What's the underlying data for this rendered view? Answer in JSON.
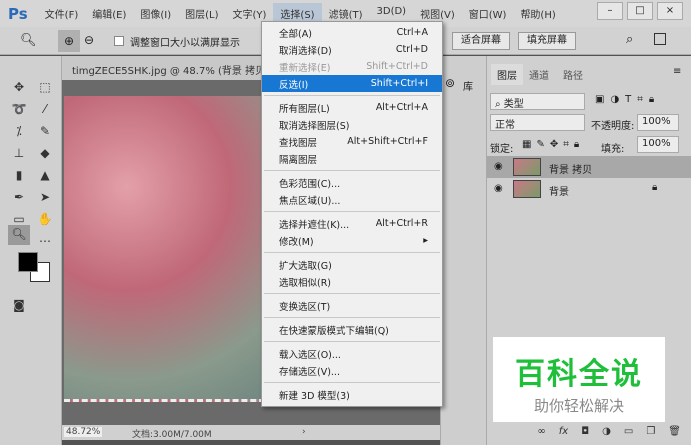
{
  "app": {
    "logo": "Ps"
  },
  "menubar": [
    "文件(F)",
    "编辑(E)",
    "图像(I)",
    "图层(L)",
    "文字(Y)",
    "选择(S)",
    "滤镜(T)",
    "3D(D)",
    "视图(V)",
    "窗口(W)",
    "帮助(H)"
  ],
  "window_buttons": [
    "–",
    "□",
    "×"
  ],
  "options": {
    "resize_label": "调整窗口大小以满屏显示",
    "fit_screen": "适合屏幕",
    "fill_screen": "填充屏幕"
  },
  "document": {
    "tab_title": "timgZECE5SHK.jpg @ 48.7% (背景 拷贝, RG",
    "zoom": "48.72%",
    "doc_size": "文档:3.00M/7.00M"
  },
  "library": {
    "label": "库"
  },
  "layers_panel": {
    "tabs": [
      "图层",
      "通道",
      "路径"
    ],
    "filter": "类型",
    "blend_mode": "正常",
    "opacity_label": "不透明度:",
    "opacity": "100%",
    "lock_label": "锁定:",
    "fill_label": "填充:",
    "fill": "100%",
    "layers": [
      {
        "name": "背景 拷贝",
        "selected": true
      },
      {
        "name": "背景",
        "locked": true
      }
    ]
  },
  "select_menu": [
    {
      "label": "全部(A)",
      "shortcut": "Ctrl+A"
    },
    {
      "label": "取消选择(D)",
      "shortcut": "Ctrl+D"
    },
    {
      "label": "重新选择(E)",
      "shortcut": "Shift+Ctrl+D",
      "disabled": true
    },
    {
      "label": "反选(I)",
      "shortcut": "Shift+Ctrl+I",
      "highlighted": true
    },
    {
      "sep": true
    },
    {
      "label": "所有图层(L)",
      "shortcut": "Alt+Ctrl+A"
    },
    {
      "label": "取消选择图层(S)",
      "shortcut": ""
    },
    {
      "label": "查找图层",
      "shortcut": "Alt+Shift+Ctrl+F"
    },
    {
      "label": "隔离图层",
      "shortcut": ""
    },
    {
      "sep": true
    },
    {
      "label": "色彩范围(C)...",
      "shortcut": ""
    },
    {
      "label": "焦点区域(U)...",
      "shortcut": ""
    },
    {
      "sep": true
    },
    {
      "label": "选择并遮住(K)...",
      "shortcut": "Alt+Ctrl+R"
    },
    {
      "label": "修改(M)",
      "shortcut": "▸"
    },
    {
      "sep": true
    },
    {
      "label": "扩大选取(G)",
      "shortcut": ""
    },
    {
      "label": "选取相似(R)",
      "shortcut": ""
    },
    {
      "sep": true
    },
    {
      "label": "变换选区(T)",
      "shortcut": ""
    },
    {
      "sep": true
    },
    {
      "label": "在快速蒙版模式下编辑(Q)",
      "shortcut": ""
    },
    {
      "sep": true
    },
    {
      "label": "载入选区(O)...",
      "shortcut": ""
    },
    {
      "label": "存储选区(V)...",
      "shortcut": ""
    },
    {
      "sep": true
    },
    {
      "label": "新建 3D 模型(3)",
      "shortcut": ""
    }
  ],
  "watermark": {
    "title": "百科全说",
    "subtitle": "助你轻松解决"
  },
  "colors": {
    "accent": "#1877d2",
    "watermark_green": "#1fbf3a"
  }
}
